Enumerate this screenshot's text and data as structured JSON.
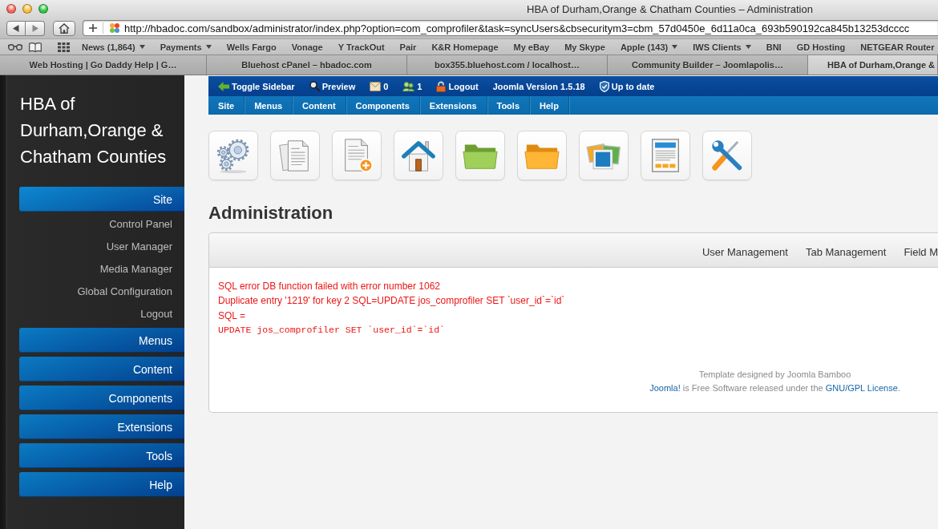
{
  "browser": {
    "title": "HBA of Durham,Orange & Chatham Counties – Administration",
    "url": "http://hbadoc.com/sandbox/administrator/index.php?option=com_comprofiler&task=syncUsers&cbsecuritym3=cbm_57d0450e_6d11a0ca_693b590192ca845b13253dcccc",
    "bookmarks": [
      {
        "label": "News (1,864)",
        "dropdown": true
      },
      {
        "label": "Payments",
        "dropdown": true
      },
      {
        "label": "Wells Fargo",
        "dropdown": false
      },
      {
        "label": "Vonage",
        "dropdown": false
      },
      {
        "label": "Y TrackOut",
        "dropdown": false
      },
      {
        "label": "Pair",
        "dropdown": false
      },
      {
        "label": "K&R Homepage",
        "dropdown": false
      },
      {
        "label": "My eBay",
        "dropdown": false
      },
      {
        "label": "My Skype",
        "dropdown": false
      },
      {
        "label": "Apple (143)",
        "dropdown": true
      },
      {
        "label": "IWS Clients",
        "dropdown": true
      },
      {
        "label": "BNI",
        "dropdown": false
      },
      {
        "label": "GD Hosting",
        "dropdown": false
      },
      {
        "label": "NETGEAR Router",
        "dropdown": false
      }
    ],
    "tabs": [
      {
        "label": "Web Hosting | Go Daddy Help | G…",
        "selected": false
      },
      {
        "label": "Bluehost cPanel – hbadoc.com",
        "selected": false
      },
      {
        "label": "box355.bluehost.com / localhost…",
        "selected": false
      },
      {
        "label": "Community Builder – Joomlapolis…",
        "selected": false
      },
      {
        "label": "HBA of Durham,Orange &",
        "selected": true
      }
    ]
  },
  "sidebar": {
    "title": "HBA of Durham,Orange & Chatham Counties",
    "sections": [
      {
        "label": "Site",
        "expanded": true,
        "children": [
          {
            "label": "Control Panel"
          },
          {
            "label": "User Manager"
          },
          {
            "label": "Media Manager"
          },
          {
            "label": "Global Configuration"
          },
          {
            "label": "Logout"
          }
        ]
      },
      {
        "label": "Menus",
        "expanded": false
      },
      {
        "label": "Content",
        "expanded": false
      },
      {
        "label": "Components",
        "expanded": false
      },
      {
        "label": "Extensions",
        "expanded": false
      },
      {
        "label": "Tools",
        "expanded": false
      },
      {
        "label": "Help",
        "expanded": false
      }
    ]
  },
  "topbar": {
    "items": [
      {
        "kind": "toggle",
        "label": "Toggle Sidebar"
      },
      {
        "kind": "preview",
        "label": "Preview"
      },
      {
        "kind": "messages",
        "label": "0"
      },
      {
        "kind": "users",
        "label": "1"
      },
      {
        "kind": "logout",
        "label": "Logout"
      },
      {
        "kind": "version",
        "label": "Joomla Version 1.5.18"
      },
      {
        "kind": "status",
        "label": "Up to date"
      }
    ]
  },
  "menubar": {
    "items": [
      "Site",
      "Menus",
      "Content",
      "Components",
      "Extensions",
      "Tools",
      "Help"
    ]
  },
  "page_title": "Administration",
  "panel": {
    "tabs": [
      {
        "label": "User Management"
      },
      {
        "label": "Tab Management"
      },
      {
        "label": "Field M"
      }
    ],
    "messages": [
      {
        "kind": "text",
        "text": "SQL error DB function failed with error number 1062"
      },
      {
        "kind": "text",
        "text": "Duplicate entry '1219' for key 2 SQL=UPDATE jos_comprofiler SET `user_id`=`id`"
      },
      {
        "kind": "text",
        "text": "SQL ="
      },
      {
        "kind": "code",
        "text": "UPDATE jos_comprofiler SET `user_id`=`id`"
      }
    ]
  },
  "footer": {
    "credit": "Template designed by Joomla Bamboo",
    "license": [
      {
        "text": "Joomla!",
        "link": true
      },
      {
        "text": " is Free Software released under the ",
        "link": false
      },
      {
        "text": "GNU/GPL License",
        "link": true
      },
      {
        "text": ".",
        "link": false
      }
    ]
  }
}
